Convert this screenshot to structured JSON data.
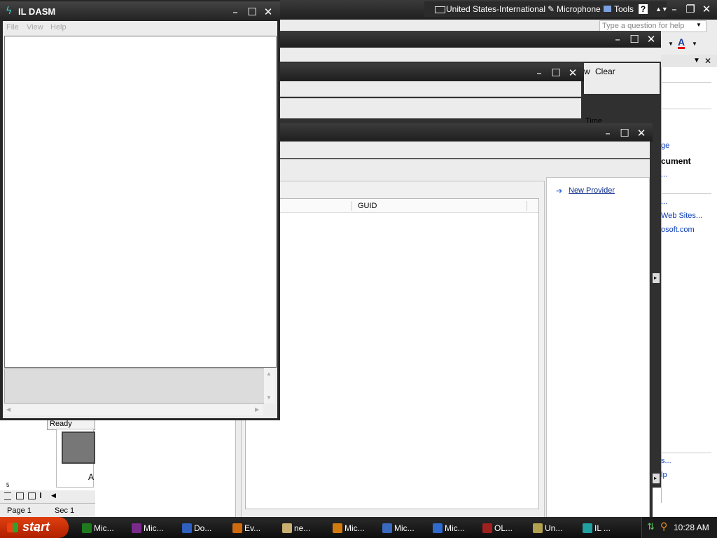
{
  "langbar": {
    "language": "United States-International",
    "microphone": "Microphone",
    "tools": "Tools",
    "help_glyph": "?"
  },
  "word_window": {
    "help_placeholder": "Type a question for help",
    "font_color_glyph": "A",
    "status_page": "Page 1",
    "status_sec": "Sec 1",
    "status_ready": "Ready",
    "ruler_mark": "5",
    "ruler_mark2": "A"
  },
  "right_pane": {
    "items": [
      "ge",
      "cument",
      "...",
      "...",
      "Web Sites...",
      "osoft.com",
      "s...",
      "lp"
    ]
  },
  "event_window": {
    "clear": "Clear",
    "w_fragment": "w",
    "time_fragment": "Time"
  },
  "wmi_window": {
    "column_guid": "GUID",
    "new_provider": "New Provider"
  },
  "ildasm": {
    "title": "IL DASM",
    "menu": [
      "File",
      "View",
      "Help"
    ]
  },
  "taskbar": {
    "start": "start",
    "clock": "10:28 AM",
    "tasks": [
      {
        "label": "Mic...",
        "icon": "excel-icon",
        "color": "#1f7a1f"
      },
      {
        "label": "Mic...",
        "icon": "publisher-icon",
        "color": "#7a2a8a"
      },
      {
        "label": "Do...",
        "icon": "word-doc-icon",
        "color": "#2f5fbf"
      },
      {
        "label": "Ev...",
        "icon": "event-viewer-icon",
        "color": "#d06a10"
      },
      {
        "label": "ne...",
        "icon": "notepad-icon",
        "color": "#c9b070"
      },
      {
        "label": "Mic...",
        "icon": "powerpoint-icon",
        "color": "#d07a10"
      },
      {
        "label": "Mic...",
        "icon": "visio-icon",
        "color": "#3a6abf"
      },
      {
        "label": "Mic...",
        "icon": "frontpage-icon",
        "color": "#2f6acf"
      },
      {
        "label": "OL...",
        "icon": "ole-view-icon",
        "color": "#a02020"
      },
      {
        "label": "Un...",
        "icon": "unknown-app-icon",
        "color": "#b0a050"
      },
      {
        "label": "IL ...",
        "icon": "ildasm-icon",
        "color": "#20a0a0"
      }
    ]
  }
}
